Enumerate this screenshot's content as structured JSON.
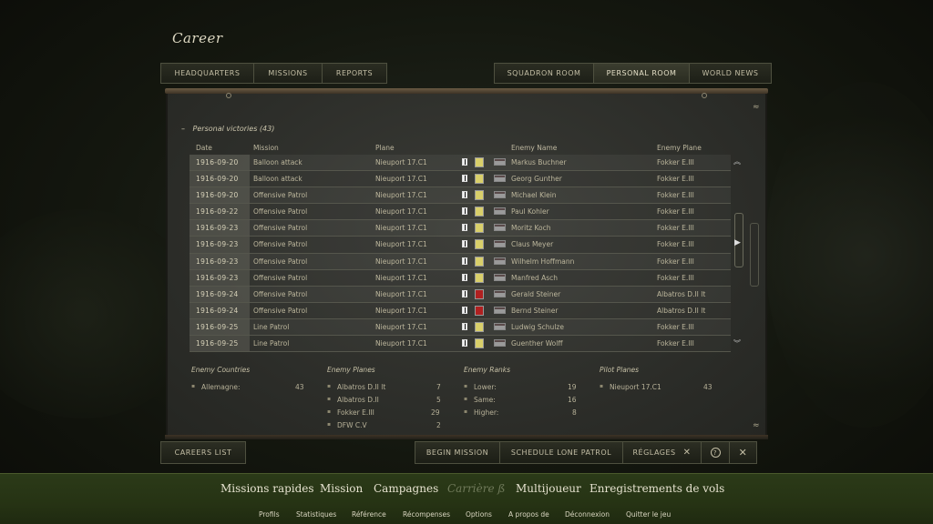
{
  "page": {
    "title": "Career"
  },
  "tabs_left": [
    "HEADQUARTERS",
    "MISSIONS",
    "REPORTS"
  ],
  "tabs_right": [
    "SQUADRON ROOM",
    "PERSONAL ROOM",
    "WORLD NEWS"
  ],
  "section": {
    "collapse": "–",
    "title": "Personal victories (43)"
  },
  "columns": {
    "date": "Date",
    "mission": "Mission",
    "plane": "Plane",
    "enemy_name": "Enemy Name",
    "enemy_plane": "Enemy Plane"
  },
  "rows": [
    {
      "date": "1916-09-20",
      "mission": "Balloon attack",
      "plane": "Nieuport 17.C1",
      "enemy": "Markus Buchner",
      "enemy_plane": "Fokker E.III"
    },
    {
      "date": "1916-09-20",
      "mission": "Balloon attack",
      "plane": "Nieuport 17.C1",
      "enemy": "Georg Gunther",
      "enemy_plane": "Fokker E.III"
    },
    {
      "date": "1916-09-20",
      "mission": "Offensive Patrol",
      "plane": "Nieuport 17.C1",
      "enemy": "Michael Klein",
      "enemy_plane": "Fokker E.III"
    },
    {
      "date": "1916-09-22",
      "mission": "Offensive Patrol",
      "plane": "Nieuport 17.C1",
      "enemy": "Paul Kohler",
      "enemy_plane": "Fokker E.III"
    },
    {
      "date": "1916-09-23",
      "mission": "Offensive Patrol",
      "plane": "Nieuport 17.C1",
      "enemy": "Moritz Koch",
      "enemy_plane": "Fokker E.III"
    },
    {
      "date": "1916-09-23",
      "mission": "Offensive Patrol",
      "plane": "Nieuport 17.C1",
      "enemy": "Claus Meyer",
      "enemy_plane": "Fokker E.III"
    },
    {
      "date": "1916-09-23",
      "mission": "Offensive Patrol",
      "plane": "Nieuport 17.C1",
      "enemy": "Wilhelm Hoffmann",
      "enemy_plane": "Fokker E.III"
    },
    {
      "date": "1916-09-23",
      "mission": "Offensive Patrol",
      "plane": "Nieuport 17.C1",
      "enemy": "Manfred Asch",
      "enemy_plane": "Fokker E.III"
    },
    {
      "date": "1916-09-24",
      "mission": "Offensive Patrol",
      "plane": "Nieuport 17.C1",
      "enemy": "Gerald Steiner",
      "enemy_plane": "Albatros D.II lt"
    },
    {
      "date": "1916-09-24",
      "mission": "Offensive Patrol",
      "plane": "Nieuport 17.C1",
      "enemy": "Bernd Steiner",
      "enemy_plane": "Albatros D.II lt"
    },
    {
      "date": "1916-09-25",
      "mission": "Line Patrol",
      "plane": "Nieuport 17.C1",
      "enemy": "Ludwig Schulze",
      "enemy_plane": "Fokker E.III"
    },
    {
      "date": "1916-09-25",
      "mission": "Line Patrol",
      "plane": "Nieuport 17.C1",
      "enemy": "Guenther Wolff",
      "enemy_plane": "Fokker E.III"
    }
  ],
  "pilot_flag_colors": [
    "#d9cf6a",
    "#d9cf6a",
    "#d9cf6a",
    "#d9cf6a",
    "#d9cf6a",
    "#d9cf6a",
    "#d9cf6a",
    "#d9cf6a",
    "#b02020",
    "#b02020",
    "#d9cf6a",
    "#d9cf6a"
  ],
  "stats": {
    "countries": {
      "title": "Enemy Countries",
      "items": [
        {
          "label": "Allemagne:",
          "value": "43"
        }
      ]
    },
    "planes": {
      "title": "Enemy Planes",
      "items": [
        {
          "label": "Albatros D.II lt",
          "value": "7"
        },
        {
          "label": "Albatros D.II",
          "value": "5"
        },
        {
          "label": "Fokker E.III",
          "value": "29"
        },
        {
          "label": "DFW C.V",
          "value": "2"
        }
      ]
    },
    "ranks": {
      "title": "Enemy Ranks",
      "items": [
        {
          "label": "Lower:",
          "value": "19"
        },
        {
          "label": "Same:",
          "value": "16"
        },
        {
          "label": "Higher:",
          "value": "8"
        }
      ]
    },
    "pilot_planes": {
      "title": "Pilot Planes",
      "items": [
        {
          "label": "Nieuport 17.C1",
          "value": "43"
        }
      ]
    }
  },
  "buttons": {
    "careers_list": "CAREERS LIST",
    "begin_mission": "BEGIN MISSION",
    "schedule_lone_patrol": "SCHEDULE LONE PATROL",
    "settings": "RÉGLAGES"
  },
  "main_nav": [
    "Missions rapides",
    "Mission",
    "Campagnes",
    "Carrière ß",
    "Multijoueur",
    "Enregistrements de vols"
  ],
  "sub_nav": [
    "Profils",
    "Statistiques",
    "Référence",
    "Récompenses",
    "Options",
    "A propos de",
    "Déconnexion",
    "Quitter le jeu"
  ]
}
